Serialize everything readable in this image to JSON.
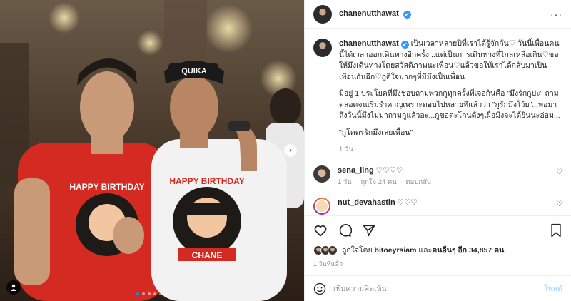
{
  "header": {
    "username": "chanenutthawat",
    "verified_symbol": "✔",
    "more_icon": "···"
  },
  "photo": {
    "next_icon": "›",
    "carousel_dots": 6,
    "active_dot": 1,
    "shirt_text": "HAPPY BIRTHDAY",
    "shirt_name": "CHANE",
    "cap_text": "QUIKA"
  },
  "caption": {
    "username": "chanenutthawat",
    "paragraph1": "เป็นเวลาหลายปีที่เราได้รู้จักกัน♡ วันนี้เพื่อนคนนี้ได้เวลาออกเดินทางอีกครั้ง...แต่เป็นการเดินทางที่ไกลเหลือเกิน♡ขอให้มึงเดินทางโดยสวัสดิภาพนะเพื่อน♡แล้วขอให้เราได้กลับมาเป็นเพื่อนกันอีก♡กูดีใจมากๆที่มีมึงเป็นเพื่อน",
    "paragraph2": "มีอยู่ 1 ประโยคที่มึงชอบถามพวกกูทุกครั้งที่เจอกันคือ \"มึงรักกูปะ\" ถามตลอดจนเริ่มรำคาญเพราะตอบไปหลายทีแล้วว่า \"กูรักมึงโว้ย\"...พอมาถึงวันนี้มึงไม่มาถามกูแล้วอะ...กูขอตะโกนดังๆเผื่อมึงจะได้ยินนะอ่อม...",
    "paragraph3": "\"กูโคตรรักมึงเลยเพื่อน\"",
    "time": "1 วัน"
  },
  "comments": [
    {
      "username": "sena_ling",
      "text": "♡♡♡♡",
      "time": "1 วัน",
      "likes": "ถูกใจ 24 คน",
      "reply": "ตอบกลับ"
    },
    {
      "username": "nut_devahastin",
      "text": "♡♡♡"
    }
  ],
  "likes": {
    "prefix": "ถูกใจโดย",
    "liker": "bitoeyrsiam",
    "connector": "และ",
    "others": "คนอื่นๆ อีก 34,857 คน"
  },
  "date": "1 วันที่แล้ว",
  "add_comment": {
    "placeholder": "เพิ่มความคิดเห็น",
    "post_label": "โพสต์"
  },
  "colors": {
    "verified": "#3897f0",
    "accent": "#0095f6",
    "post_disabled": "#b2dffc",
    "secondary_text": "#8e8e8e"
  }
}
